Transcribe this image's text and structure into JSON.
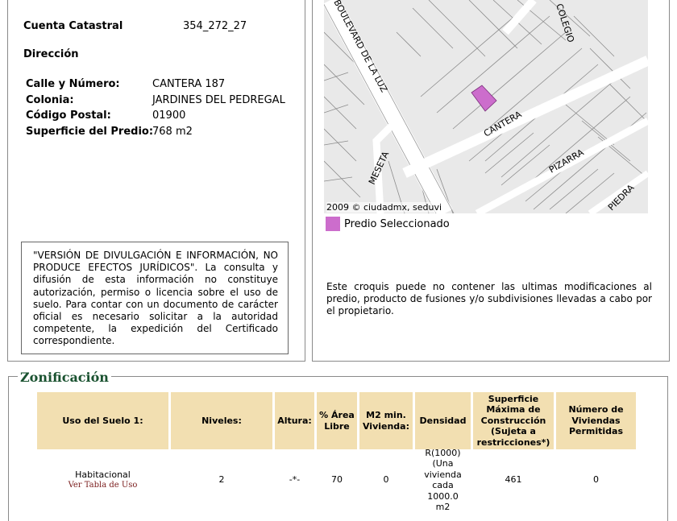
{
  "predio": {
    "cuenta_label": "Cuenta Catastral",
    "cuenta_value": "354_272_27",
    "direccion_label": "Dirección",
    "fields": [
      {
        "label": "Calle y Número:",
        "value": "CANTERA 187"
      },
      {
        "label": "Colonia:",
        "value": "JARDINES DEL PEDREGAL"
      },
      {
        "label": "Código Postal:",
        "value": "01900"
      },
      {
        "label": "Superficie del Predio:",
        "value": "768 m2"
      }
    ],
    "disclaimer": "\"VERSIÓN DE DIVULGACIÓN E INFORMACIÓN, NO PRODUCE EFECTOS JURÍDICOS\". La consulta y difusión de esta información no constituye autorización, permiso o licencia sobre el uso de suelo. Para contar con un documento de carácter oficial es necesario solicitar a la autoridad competente, la expedición del Certificado correspondiente."
  },
  "map": {
    "streets": [
      "BOULEVARD DE LA LUZ",
      "COLEGIO",
      "CANTERA",
      "MESETA",
      "PIZARRA",
      "PIEDRA"
    ],
    "credit": "2009 © ciudadmx, seduvi",
    "legend_label": "Predio Seleccionado",
    "legend_color": "#cc6dcc",
    "note": "Este croquis puede no contener las ultimas modificaciones al predio, producto de fusiones y/o subdivisiones llevadas a cabo por el propietario."
  },
  "zonificacion": {
    "title": "Zonificación",
    "header_color": "#f2dfb1",
    "headers": [
      "Uso del Suelo 1:",
      "Niveles:",
      "Altura:",
      "% Área Libre",
      "M2 min. Vivienda:",
      "Densidad",
      "Superficie Máxima de Construcción (Sujeta a restricciones*)",
      "Número de Viviendas Permitidas"
    ],
    "row": {
      "uso": "Habitacional",
      "uso_link": "Ver Tabla de Uso",
      "niveles": "2",
      "altura": "-*-",
      "area_libre": "70",
      "m2_min": "0",
      "densidad": "R(1000) (Una vivienda cada 1000.0 m2",
      "superficie_max": "461",
      "num_viviendas": "0"
    }
  }
}
